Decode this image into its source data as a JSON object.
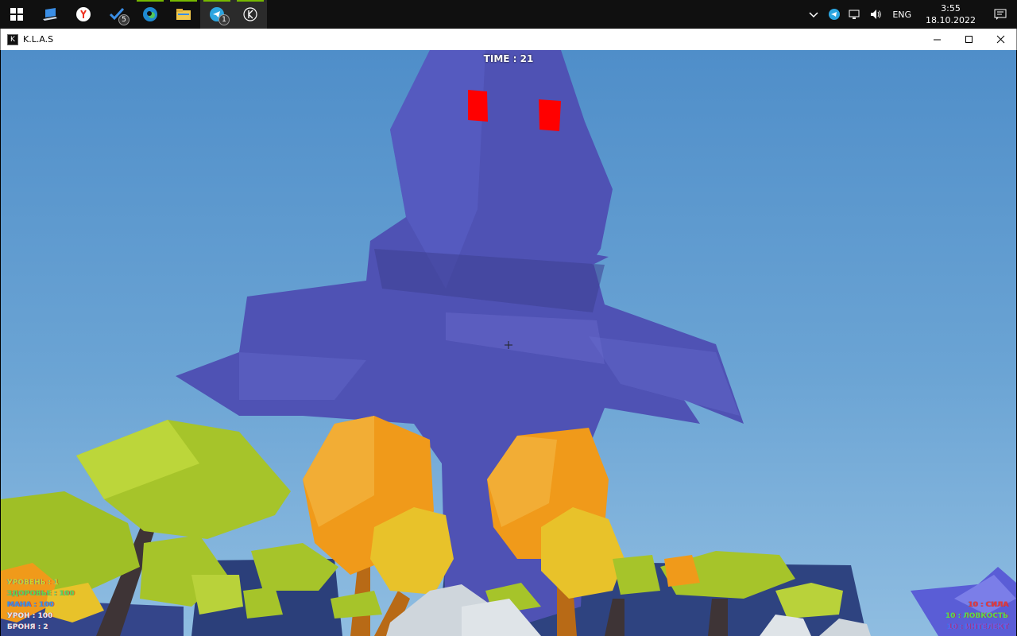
{
  "taskbar": {
    "apps": [
      {
        "name": "start",
        "icon": "windows-logo-icon"
      },
      {
        "name": "desktop",
        "icon": "laptop-icon"
      },
      {
        "name": "yandex-browser",
        "icon": "yandex-icon"
      },
      {
        "name": "todo",
        "icon": "checkmark-icon",
        "badge": "5"
      },
      {
        "name": "edge",
        "icon": "edge-icon"
      },
      {
        "name": "explorer",
        "icon": "folder-icon"
      },
      {
        "name": "telegram",
        "icon": "telegram-icon",
        "badge": "1"
      },
      {
        "name": "klas",
        "icon": "klas-icon"
      }
    ],
    "tray": {
      "language": "ENG",
      "time": "3:55",
      "date": "18.10.2022"
    }
  },
  "window": {
    "title": "K.L.A.S",
    "icon_letter": "K"
  },
  "game": {
    "timer": "TIME : 21",
    "stats_left": [
      {
        "text": "УРОВЕНЬ : 1",
        "color": "#c8d830"
      },
      {
        "text": "ЗДОРОВЬЕ : 100",
        "color": "#5fd84a"
      },
      {
        "text": "МАНА : 100",
        "color": "#3a8fe8"
      },
      {
        "text": "УРОН : 100",
        "color": "#e8e8e8"
      },
      {
        "text": "БРОНЯ : 2",
        "color": "#e8e8e8"
      }
    ],
    "stats_right": [
      {
        "text": "10 : СИЛА",
        "color": "#e03a3a"
      },
      {
        "text": "10 : ЛОВКОСТЬ",
        "color": "#5fd84a"
      },
      {
        "text": "10 : ИНТЕЛЕКТ",
        "color": "#6a5ae8"
      }
    ]
  },
  "colors": {
    "sky_top": "#4f8ec9",
    "monster": "#5055b8",
    "monster_eyes": "#ff0000",
    "tree_green": "#a6c42a",
    "tree_orange": "#f09a1a",
    "tree_yellow": "#e8c22a"
  }
}
